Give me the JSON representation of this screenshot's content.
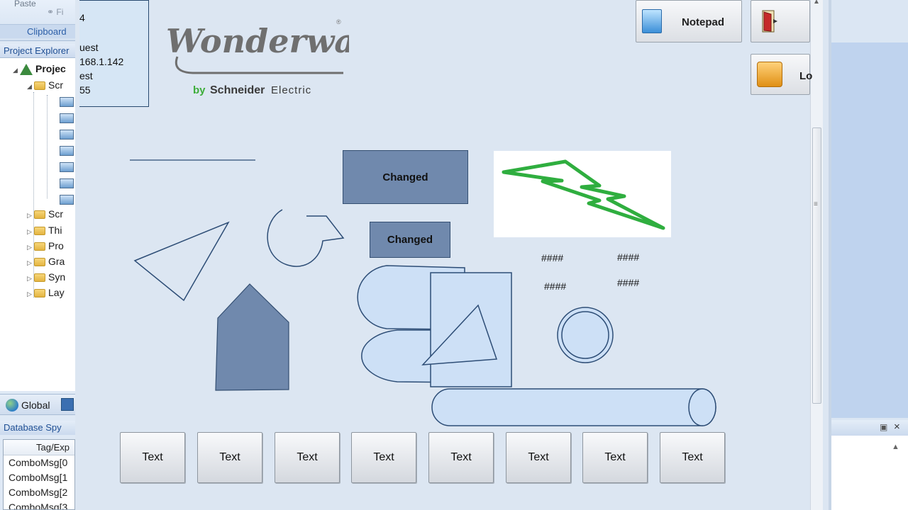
{
  "ide": {
    "ribbon": {
      "paste": "Paste",
      "find": "Fi",
      "clipboard": "Clipboard"
    },
    "project_explorer": {
      "title": "Project Explorer",
      "tree": [
        {
          "label": "Projec",
          "level": 0,
          "icon": "project-icon",
          "expanded": true
        },
        {
          "label": "Scr",
          "level": 1,
          "icon": "folder-icon",
          "expanded": true
        },
        {
          "label": "",
          "level": 2,
          "icon": "screen-icon"
        },
        {
          "label": "",
          "level": 2,
          "icon": "screen-icon"
        },
        {
          "label": "",
          "level": 2,
          "icon": "screen-icon"
        },
        {
          "label": "",
          "level": 2,
          "icon": "screen-icon"
        },
        {
          "label": "",
          "level": 2,
          "icon": "screen-icon"
        },
        {
          "label": "",
          "level": 2,
          "icon": "screen-icon"
        },
        {
          "label": "",
          "level": 2,
          "icon": "screen-icon"
        },
        {
          "label": "Scr",
          "level": 1,
          "icon": "folder-icon"
        },
        {
          "label": "Thi",
          "level": 1,
          "icon": "folder-icon"
        },
        {
          "label": "Pro",
          "level": 1,
          "icon": "folder-icon"
        },
        {
          "label": "Gra",
          "level": 1,
          "icon": "graphics-icon"
        },
        {
          "label": "Syn",
          "level": 1,
          "icon": "symbols-icon"
        },
        {
          "label": "Lay",
          "level": 1,
          "icon": "layout-icon"
        }
      ]
    },
    "global_tab": "Global",
    "database_spy": {
      "title": "Database Spy",
      "column": "Tag/Exp",
      "rows": [
        "ComboMsg[0",
        "ComboMsg[1",
        "ComboMsg[2",
        "ComboMsg[3"
      ]
    }
  },
  "runtime": {
    "info_lines": [
      "4",
      "uest",
      "168.1.142",
      "est",
      "55"
    ],
    "logo": {
      "wordmark": "Wonderware",
      "registered": "®",
      "by": "by",
      "brand": "Schneider",
      "electric": "Electric"
    },
    "notepad_label": "Notepad",
    "login_label": "Lo",
    "changed_labels": [
      "Changed",
      "Changed"
    ],
    "hash_values": [
      "####",
      "####",
      "####",
      "####"
    ],
    "text_buttons": [
      "Text",
      "Text",
      "Text",
      "Text",
      "Text",
      "Text",
      "Text",
      "Text"
    ]
  },
  "colors": {
    "shape_fill": "#cde0f6",
    "shape_stroke": "#2d4d76",
    "dark_fill": "#7089ad",
    "bolt": "#2fae3f"
  }
}
